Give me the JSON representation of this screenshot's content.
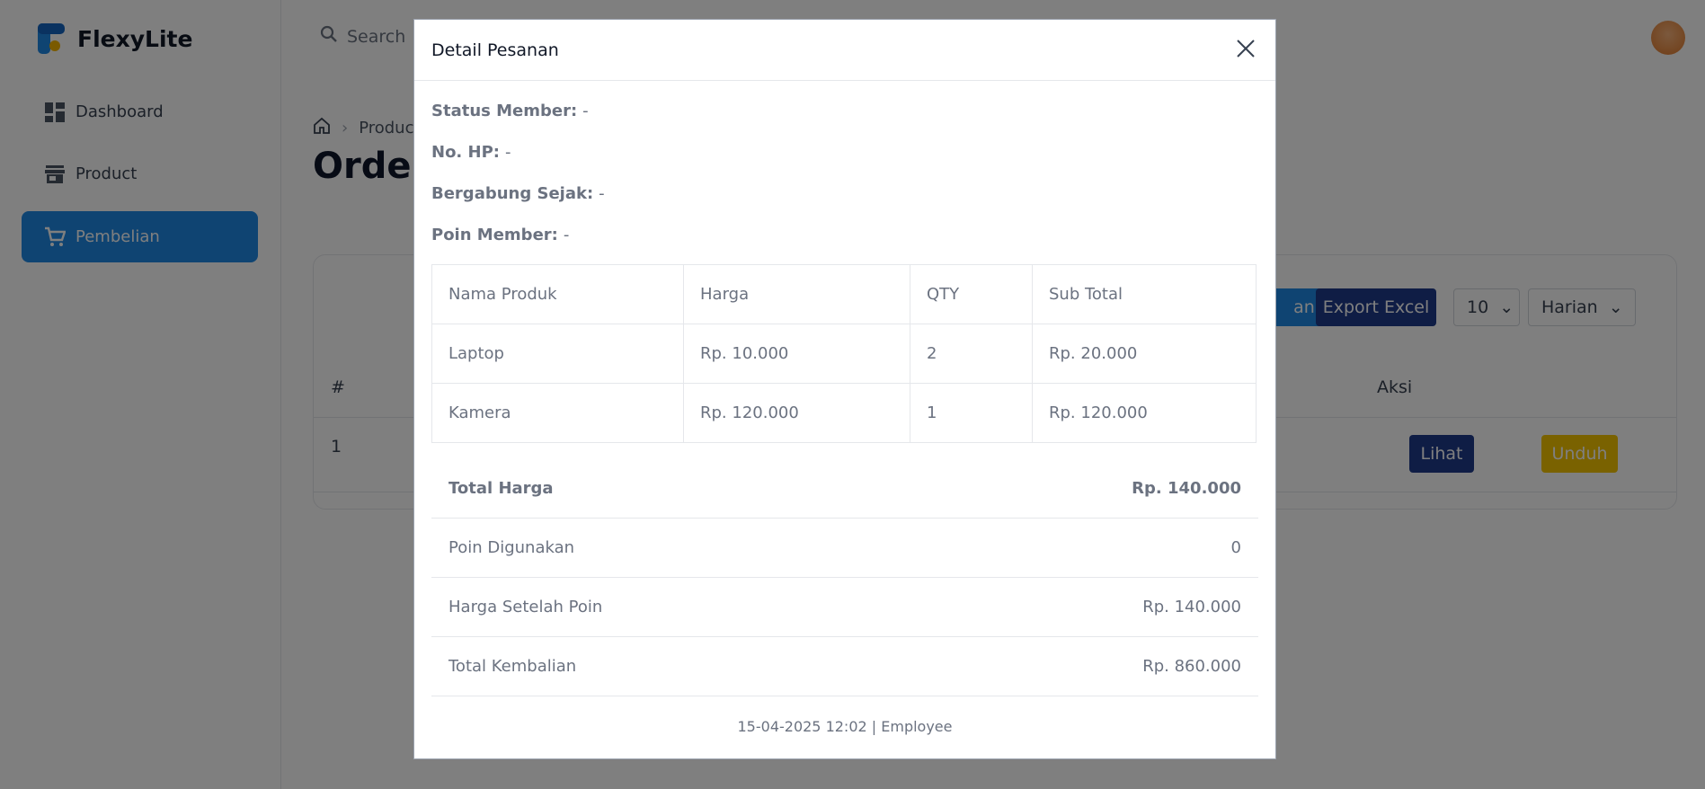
{
  "app": {
    "name": "FlexyLite"
  },
  "sidebar": {
    "items": [
      {
        "label": "Dashboard",
        "icon": "dashboard-icon"
      },
      {
        "label": "Product",
        "icon": "store-icon"
      },
      {
        "label": "Pembelian",
        "icon": "cart-icon",
        "active": true
      }
    ]
  },
  "topbar": {
    "search_placeholder": "Search"
  },
  "breadcrumb": {
    "item": "Produc"
  },
  "page": {
    "title": "Orders"
  },
  "toolbar": {
    "partial_button": "an",
    "export_label": "Export Excel",
    "per_page": "10",
    "period": "Harian"
  },
  "table": {
    "col_index": "#",
    "col_action": "Aksi",
    "row": {
      "index": "1",
      "view_label": "Lihat",
      "download_label": "Unduh"
    }
  },
  "modal": {
    "title": "Detail Pesanan",
    "info": [
      {
        "label": "Status Member:",
        "value": "-"
      },
      {
        "label": "No. HP:",
        "value": "-"
      },
      {
        "label": "Bergabung Sejak:",
        "value": "-"
      },
      {
        "label": "Poin Member:",
        "value": "-"
      }
    ],
    "items_table": {
      "headers": [
        "Nama Produk",
        "Harga",
        "QTY",
        "Sub Total"
      ],
      "rows": [
        [
          "Laptop",
          "Rp. 10.000",
          "2",
          "Rp. 20.000"
        ],
        [
          "Kamera",
          "Rp. 120.000",
          "1",
          "Rp. 120.000"
        ]
      ]
    },
    "summary": [
      {
        "label": "Total Harga",
        "value": "Rp. 140.000"
      },
      {
        "label": "Poin Digunakan",
        "value": "0"
      },
      {
        "label": "Harga Setelah Poin",
        "value": "Rp. 140.000"
      },
      {
        "label": "Total Kembalian",
        "value": "Rp. 860.000"
      }
    ],
    "footer": "15-04-2025 12:02 | Employee"
  },
  "colors": {
    "primary": "#1e88e5",
    "navy": "#1e3a8a",
    "yellow": "#f5c400",
    "overlay": "rgba(0,0,0,0.5)"
  }
}
